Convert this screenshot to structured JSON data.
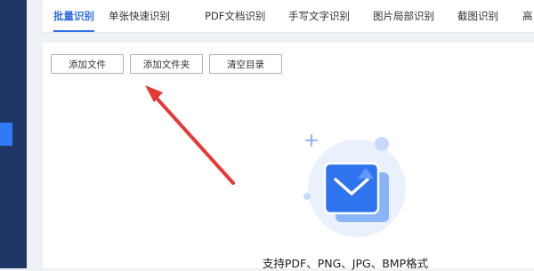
{
  "tabs": [
    {
      "label": "批量识别",
      "active": true
    },
    {
      "label": "单张快速识别",
      "active": false
    },
    {
      "label": "PDF文档识别",
      "active": false
    },
    {
      "label": "手写文字识别",
      "active": false
    },
    {
      "label": "图片局部识别",
      "active": false
    },
    {
      "label": "截图识别",
      "active": false
    },
    {
      "label": "高",
      "active": false
    }
  ],
  "toolbar": {
    "add_file_label": "添加文件",
    "add_folder_label": "添加文件夹",
    "clear_list_label": "清空目录"
  },
  "dropzone": {
    "hint": "支持PDF、PNG、JPG、BMP格式",
    "icon": "image-upload-icon"
  },
  "colors": {
    "accent": "#2f6fe8",
    "sidebar": "#1d3666",
    "annotation_arrow": "#e53935"
  }
}
